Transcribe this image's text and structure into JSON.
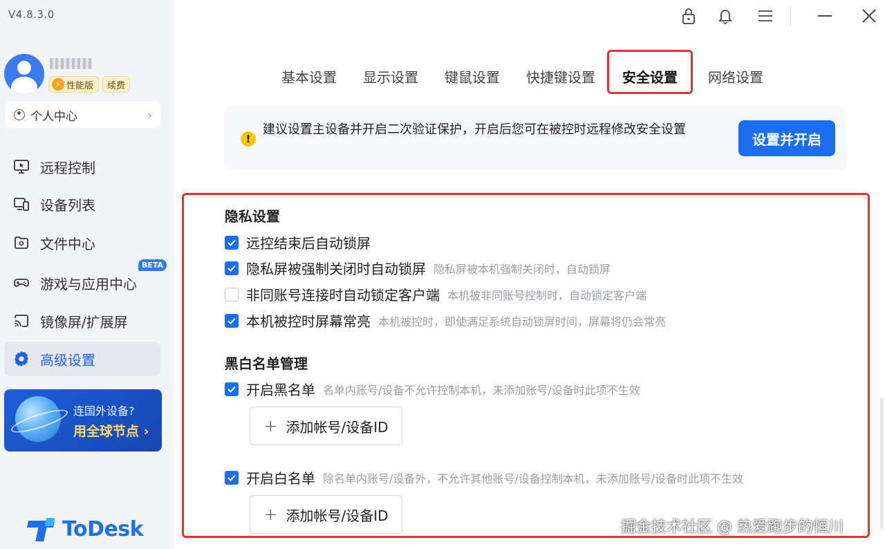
{
  "sidebar": {
    "version": "V4.8.3.0",
    "badge_perf": "性能版",
    "badge_renew": "续费",
    "personal_center": "个人中心",
    "items": [
      {
        "label": "远程控制",
        "icon": "monitor-icon"
      },
      {
        "label": "设备列表",
        "icon": "devices-icon"
      },
      {
        "label": "文件中心",
        "icon": "folder-icon"
      },
      {
        "label": "游戏与应用中心",
        "icon": "gamepad-icon"
      },
      {
        "label": "镜像屏/扩展屏",
        "icon": "cast-icon"
      },
      {
        "label": "高级设置",
        "icon": "gear-icon"
      }
    ],
    "beta_badge": "BETA",
    "promo": {
      "line1": "连国外设备?",
      "line2": "用全球节点 ›"
    },
    "logo_text": "ToDesk"
  },
  "window_controls": [
    "lock-icon",
    "bell-icon",
    "menu-icon",
    "minimize-icon",
    "close-icon"
  ],
  "tabs": [
    {
      "label": "基本设置"
    },
    {
      "label": "显示设置"
    },
    {
      "label": "键鼠设置"
    },
    {
      "label": "快捷键设置"
    },
    {
      "label": "安全设置",
      "active": true
    },
    {
      "label": "网络设置"
    }
  ],
  "notice": {
    "text": "建议设置主设备并开启二次验证保护，开启后您可在被控时远程修改安全设置",
    "button": "设置并开启"
  },
  "privacy": {
    "title": "隐私设置",
    "options": [
      {
        "label": "远控结束后自动锁屏",
        "desc": "",
        "checked": true
      },
      {
        "label": "隐私屏被强制关闭时自动锁屏",
        "desc": "隐私屏被本机强制关闭时，自动锁屏",
        "checked": true
      },
      {
        "label": "非同账号连接时自动锁定客户端",
        "desc": "本机被非同账号控制时，自动锁定客户端",
        "checked": false
      },
      {
        "label": "本机被控时屏幕常亮",
        "desc": "本机被控时，即使满足系统自动锁屏时间，屏幕将仍会常亮",
        "checked": true
      }
    ]
  },
  "lists": {
    "title": "黑白名单管理",
    "blacklist": {
      "label": "开启黑名单",
      "desc": "名单内账号/设备不允许控制本机，未添加账号/设备时此项不生效",
      "checked": true,
      "add_button": "添加帐号/设备ID"
    },
    "whitelist": {
      "label": "开启白名单",
      "desc": "除名单内账号/设备外，不允许其他账号/设备控制本机，未添加账号/设备时此项不生效",
      "checked": true,
      "add_button": "添加帐号/设备ID"
    }
  },
  "watermark": "掘金技术社区 @ 热爱跑步的恒川",
  "colors": {
    "accent": "#1a6ff0",
    "highlight_border": "#e23232",
    "promo_bg": "#1d5ed8"
  }
}
